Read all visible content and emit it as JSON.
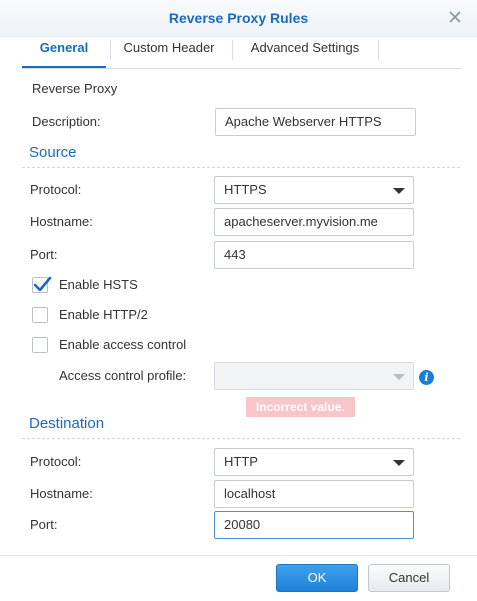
{
  "dialog": {
    "title": "Reverse Proxy Rules"
  },
  "tabs": [
    {
      "label": "General"
    },
    {
      "label": "Custom Header"
    },
    {
      "label": "Advanced Settings"
    }
  ],
  "general": {
    "group_label": "Reverse Proxy",
    "description_label": "Description:",
    "description_value": "Apache Webserver HTTPS"
  },
  "source": {
    "heading": "Source",
    "protocol_label": "Protocol:",
    "protocol_value": "HTTPS",
    "hostname_label": "Hostname:",
    "hostname_value": "apacheserver.myvision.me",
    "port_label": "Port:",
    "port_value": "443"
  },
  "options": {
    "hsts_label": "Enable HSTS",
    "hsts_checked": true,
    "http2_label": "Enable HTTP/2",
    "http2_checked": false,
    "access_label": "Enable access control",
    "access_checked": false,
    "profile_label": "Access control profile:",
    "profile_value": "",
    "error_text": "Incorrect value."
  },
  "destination": {
    "heading": "Destination",
    "protocol_label": "Protocol:",
    "protocol_value": "HTTP",
    "hostname_label": "Hostname:",
    "hostname_value": "localhost",
    "port_label": "Port:",
    "port_value": "20080"
  },
  "buttons": {
    "ok": "OK",
    "cancel": "Cancel"
  },
  "icons": {
    "close": "close-icon",
    "info": "info-icon",
    "check": "checkmark-icon",
    "dropdown": "chevron-down-icon"
  },
  "colors": {
    "accent": "#1a6ac0",
    "primary_button": "#2a8ce4",
    "error_bg": "#f8c5c8",
    "info": "#1a7fd4"
  }
}
